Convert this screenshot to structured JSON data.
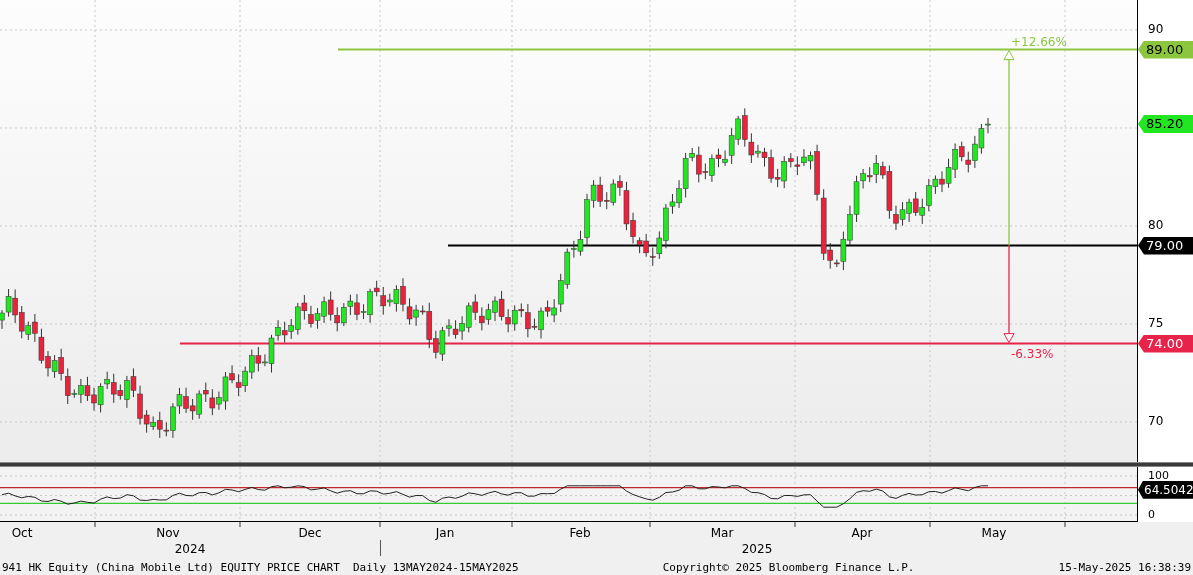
{
  "price_panel": {
    "y_axis_ticks": [
      "90",
      "80",
      "75",
      "70"
    ],
    "levels": [
      {
        "kind": "target",
        "tag": "89.00",
        "change": "+12.66%",
        "color": "#8cc63f"
      },
      {
        "kind": "last",
        "tag": "85.20",
        "color": "#22e622"
      },
      {
        "kind": "base",
        "tag": "79.00",
        "color": "#000000"
      },
      {
        "kind": "stop",
        "tag": "74.00",
        "change": "-6.33%",
        "color": "#e8234a"
      }
    ]
  },
  "indicator_panel": {
    "y_axis_ticks": [
      "100",
      "0"
    ],
    "value_tag": "64.5042"
  },
  "x_axis": {
    "months": [
      "Oct",
      "Nov",
      "Dec",
      "Jan",
      "Feb",
      "Mar",
      "Apr",
      "May"
    ],
    "years": [
      "2024",
      "2025"
    ]
  },
  "footer": {
    "title": "941 HK Equity (China Mobile Ltd) EQUITY PRICE CHART  Daily 13MAY2024-15MAY2025",
    "copyright": "Copyright© 2025 Bloomberg Finance L.P.",
    "timestamp": "15-May-2025 16:38:39"
  }
}
